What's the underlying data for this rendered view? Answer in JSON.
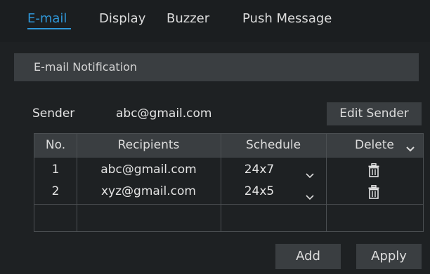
{
  "tabs": [
    {
      "label": "E-mail",
      "active": true
    },
    {
      "label": "Display"
    },
    {
      "label": "Buzzer"
    },
    {
      "label": "Push Message"
    }
  ],
  "section": {
    "title": "E-mail Notification"
  },
  "sender": {
    "label": "Sender",
    "value": "abc@gmail.com",
    "edit_label": "Edit Sender"
  },
  "table": {
    "headers": {
      "no": "No.",
      "recipients": "Recipients",
      "schedule": "Schedule",
      "delete": "Delete"
    },
    "rows": [
      {
        "no": "1",
        "recipient": "abc@gmail.com",
        "schedule": "24x7"
      },
      {
        "no": "2",
        "recipient": "xyz@gmail.com",
        "schedule": "24x5"
      }
    ]
  },
  "buttons": {
    "add": "Add",
    "apply": "Apply"
  },
  "colors": {
    "accent": "#2f97d8",
    "background": "#1e2123",
    "panel": "#3a3e41"
  }
}
